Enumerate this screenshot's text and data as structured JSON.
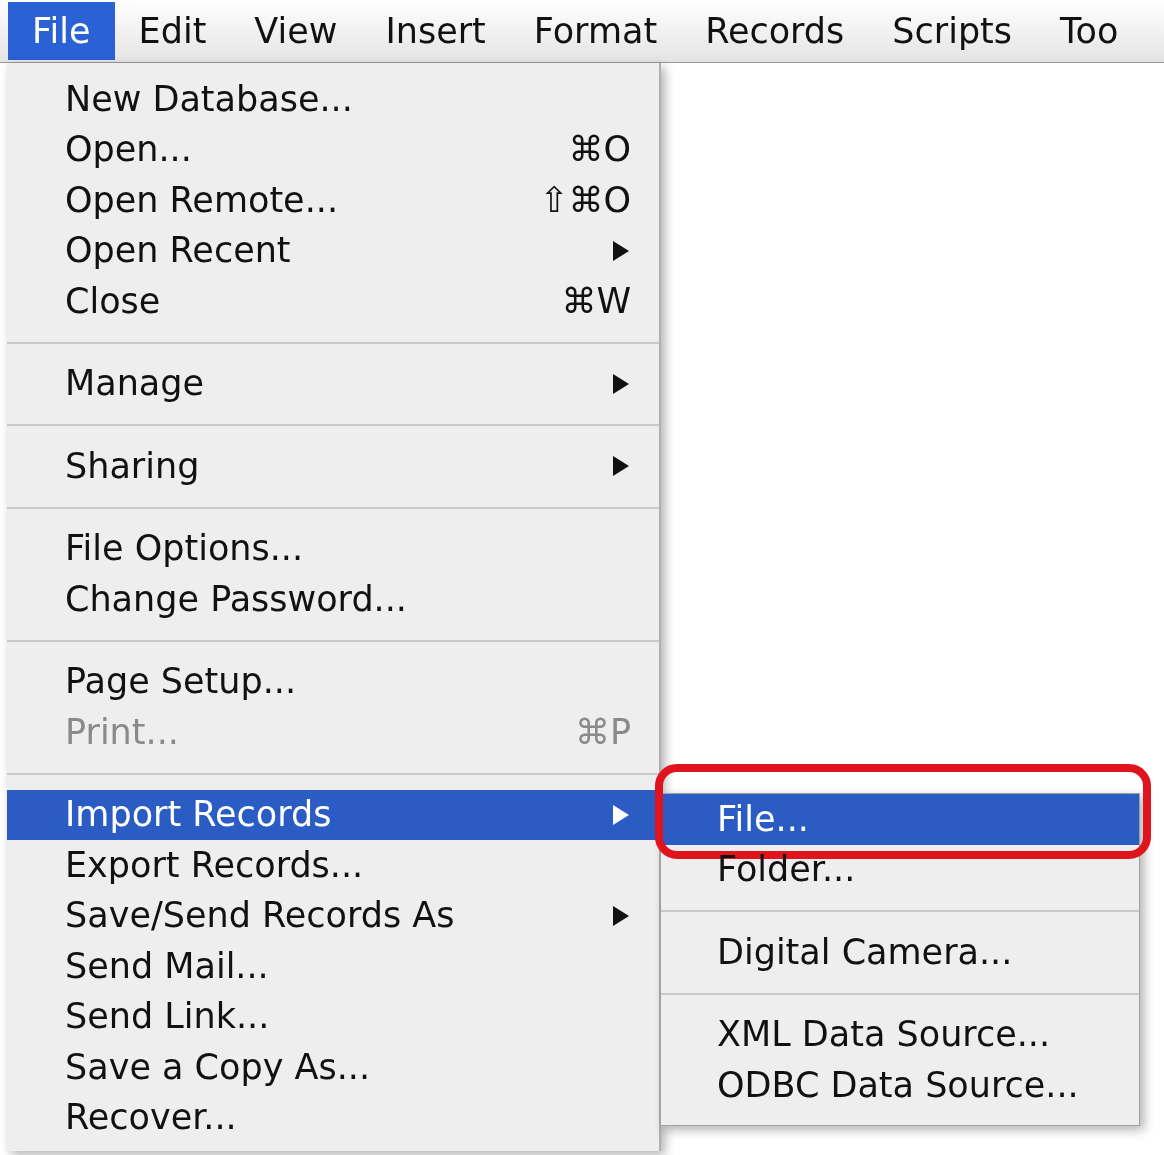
{
  "menu_bar": [
    {
      "label": "File",
      "selected": true
    },
    {
      "label": "Edit",
      "selected": false
    },
    {
      "label": "View",
      "selected": false
    },
    {
      "label": "Insert",
      "selected": false
    },
    {
      "label": "Format",
      "selected": false
    },
    {
      "label": "Records",
      "selected": false
    },
    {
      "label": "Scripts",
      "selected": false
    },
    {
      "label": "Too",
      "selected": false
    }
  ],
  "file_menu": [
    {
      "kind": "item",
      "label": "New Database...",
      "disabled": false,
      "selected": false,
      "submenu": false
    },
    {
      "kind": "item",
      "label": "Open...",
      "shortcut": "⌘O",
      "disabled": false,
      "selected": false,
      "submenu": false
    },
    {
      "kind": "item",
      "label": "Open Remote...",
      "shortcut": "⇧⌘O",
      "disabled": false,
      "selected": false,
      "submenu": false
    },
    {
      "kind": "item",
      "label": "Open Recent",
      "disabled": false,
      "selected": false,
      "submenu": true
    },
    {
      "kind": "item",
      "label": "Close",
      "shortcut": "⌘W",
      "disabled": false,
      "selected": false,
      "submenu": false
    },
    {
      "kind": "separator"
    },
    {
      "kind": "item",
      "label": "Manage",
      "disabled": false,
      "selected": false,
      "submenu": true
    },
    {
      "kind": "separator"
    },
    {
      "kind": "item",
      "label": "Sharing",
      "disabled": false,
      "selected": false,
      "submenu": true
    },
    {
      "kind": "separator"
    },
    {
      "kind": "item",
      "label": "File Options...",
      "disabled": false,
      "selected": false,
      "submenu": false
    },
    {
      "kind": "item",
      "label": "Change Password...",
      "disabled": false,
      "selected": false,
      "submenu": false
    },
    {
      "kind": "separator"
    },
    {
      "kind": "item",
      "label": "Page Setup...",
      "disabled": false,
      "selected": false,
      "submenu": false
    },
    {
      "kind": "item",
      "label": "Print...",
      "shortcut": "⌘P",
      "disabled": true,
      "selected": false,
      "submenu": false
    },
    {
      "kind": "separator"
    },
    {
      "kind": "item",
      "label": "Import Records",
      "disabled": false,
      "selected": true,
      "submenu": true
    },
    {
      "kind": "item",
      "label": "Export Records...",
      "disabled": false,
      "selected": false,
      "submenu": false
    },
    {
      "kind": "item",
      "label": "Save/Send Records As",
      "disabled": false,
      "selected": false,
      "submenu": true
    },
    {
      "kind": "item",
      "label": "Send Mail...",
      "disabled": false,
      "selected": false,
      "submenu": false
    },
    {
      "kind": "item",
      "label": "Send Link...",
      "disabled": false,
      "selected": false,
      "submenu": false
    },
    {
      "kind": "item",
      "label": "Save a Copy As...",
      "disabled": false,
      "selected": false,
      "submenu": false
    },
    {
      "kind": "item",
      "label": "Recover...",
      "disabled": false,
      "selected": false,
      "submenu": false
    }
  ],
  "import_submenu": [
    {
      "kind": "item",
      "label": "File...",
      "selected": true,
      "circled": true
    },
    {
      "kind": "item",
      "label": "Folder...",
      "selected": false,
      "circled": false
    },
    {
      "kind": "separator"
    },
    {
      "kind": "item",
      "label": "Digital Camera...",
      "selected": false,
      "circled": false
    },
    {
      "kind": "separator"
    },
    {
      "kind": "item",
      "label": "XML Data Source...",
      "selected": false,
      "circled": false
    },
    {
      "kind": "item",
      "label": "ODBC Data Source...",
      "selected": false,
      "circled": false
    }
  ]
}
